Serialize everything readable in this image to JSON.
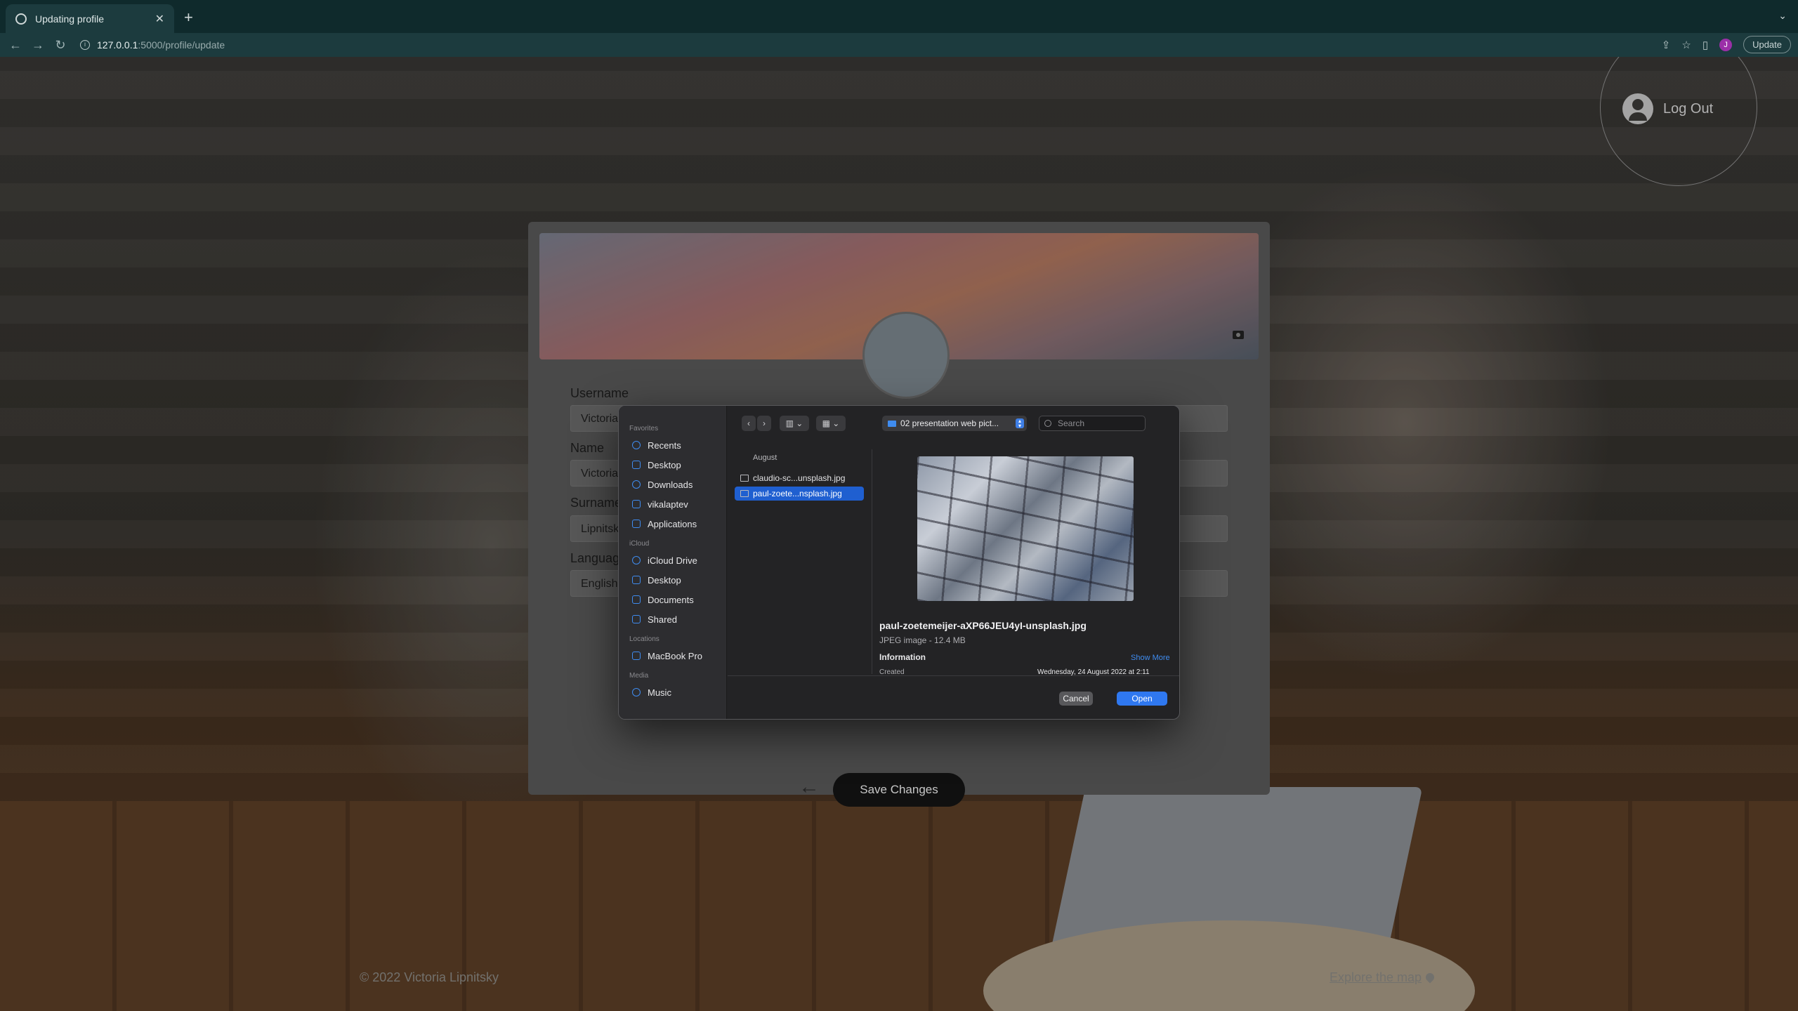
{
  "browser": {
    "tab_title": "Updating profile",
    "url_host": "127.0.0.1",
    "url_path": ":5000/profile/update",
    "profile_initial": "J",
    "update_label": "Update"
  },
  "page": {
    "logout_label": "Log Out",
    "footer_copyright": "© 2022 Victoria Lipnitsky",
    "footer_link": "Explore the map"
  },
  "profile_form": {
    "fields": [
      {
        "label": "Username",
        "value": "Victoria"
      },
      {
        "label": "Name",
        "value": "Victoria"
      },
      {
        "label": "Surname",
        "value": "Lipnitsky"
      },
      {
        "label": "Language",
        "value": "English"
      }
    ],
    "save_label": "Save Changes",
    "back_icon": "arrow-left-icon"
  },
  "file_dialog": {
    "sidebar": {
      "favorites_title": "Favorites",
      "favorites": [
        "Recents",
        "Desktop",
        "Downloads",
        "vikalaptev",
        "Applications"
      ],
      "icloud_title": "iCloud",
      "icloud": [
        "iCloud Drive",
        "Desktop",
        "Documents",
        "Shared"
      ],
      "locations_title": "Locations",
      "locations": [
        "MacBook Pro"
      ],
      "media_title": "Media",
      "media": [
        "Music"
      ]
    },
    "current_folder": "02 presentation web pict...",
    "search_placeholder": "Search",
    "list_group": "August",
    "files": [
      {
        "name": "claudio-sc...unsplash.jpg",
        "selected": false
      },
      {
        "name": "paul-zoete...nsplash.jpg",
        "selected": true
      }
    ],
    "preview": {
      "file_name": "paul-zoetemeijer-aXP66JEU4yI-unsplash.jpg",
      "meta": "JPEG image - 12.4 MB",
      "information_label": "Information",
      "show_more": "Show More",
      "created_label": "Created",
      "created_value": "Wednesday, 24 August 2022 at 2:11"
    },
    "cancel_label": "Cancel",
    "open_label": "Open",
    "accent": "#2f78f0"
  }
}
